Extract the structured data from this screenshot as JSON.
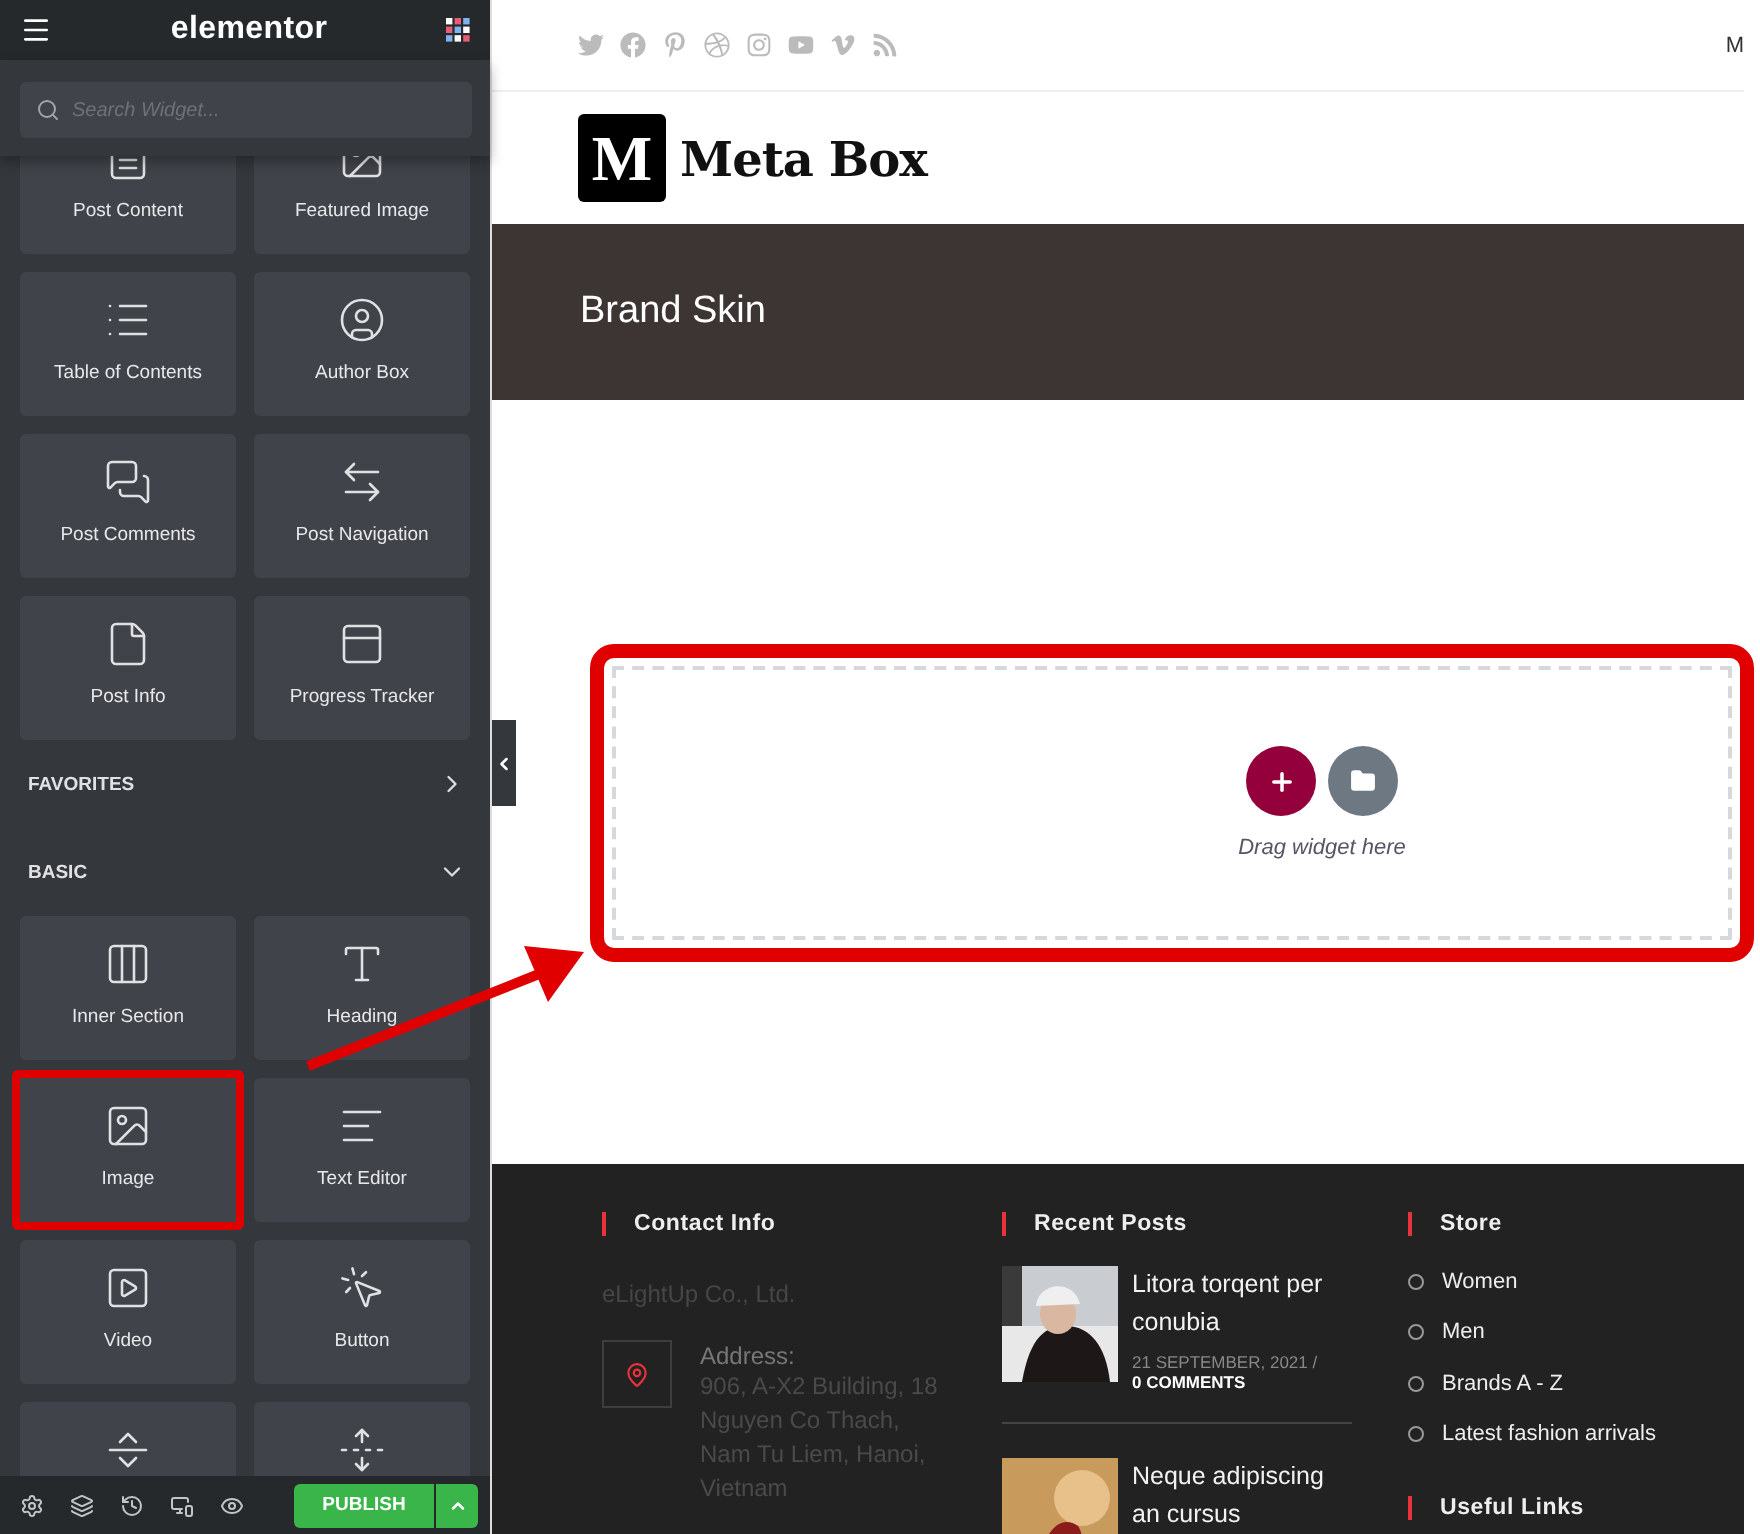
{
  "sidebar": {
    "title": "elementor",
    "search": {
      "placeholder": "Search Widget..."
    },
    "widgets": [
      {
        "label": "Post Content",
        "highlighted": false
      },
      {
        "label": "Featured Image",
        "highlighted": false
      },
      {
        "label": "Table of Contents",
        "highlighted": false
      },
      {
        "label": "Author Box",
        "highlighted": false
      },
      {
        "label": "Post Comments",
        "highlighted": false
      },
      {
        "label": "Post Navigation",
        "highlighted": false
      },
      {
        "label": "Post Info",
        "highlighted": false
      },
      {
        "label": "Progress Tracker",
        "highlighted": false
      }
    ],
    "categories": [
      {
        "label": "FAVORITES",
        "expanded": false
      },
      {
        "label": "BASIC",
        "expanded": true,
        "widgets": [
          {
            "label": "Inner Section",
            "highlighted": false
          },
          {
            "label": "Heading",
            "highlighted": false
          },
          {
            "label": "Image",
            "highlighted": true
          },
          {
            "label": "Text Editor",
            "highlighted": false
          },
          {
            "label": "Video",
            "highlighted": false
          },
          {
            "label": "Button",
            "highlighted": false
          },
          {
            "highlighted": false
          },
          {
            "highlighted": false
          }
        ]
      }
    ],
    "publish": "PUBLISH"
  },
  "page": {
    "top_nav_text": "M",
    "logo": {
      "mark": "M",
      "name": "Meta Box"
    },
    "banner_title": "Brand Skin",
    "drop_zone": {
      "hint": "Drag widget here",
      "highlighted": true
    },
    "footer": {
      "contact": {
        "heading": "Contact Info",
        "company": "eLightUp Co., Ltd.",
        "address_label": "Address:",
        "address": "906, A-X2 Building, 18 Nguyen Co Thach, Nam Tu Liem, Hanoi, Vietnam"
      },
      "recent_posts": {
        "heading": "Recent Posts",
        "posts": [
          {
            "title": "Litora torqent per conubia",
            "date": "21 SEPTEMBER, 2021 /",
            "comments": "0 COMMENTS"
          },
          {
            "title": "Neque adipiscing an cursus"
          }
        ]
      },
      "store": {
        "heading": "Store",
        "links": [
          "Women",
          "Men",
          "Brands A - Z",
          "Latest fashion arrivals"
        ]
      },
      "useful_links": {
        "heading": "Useful Links"
      }
    }
  }
}
